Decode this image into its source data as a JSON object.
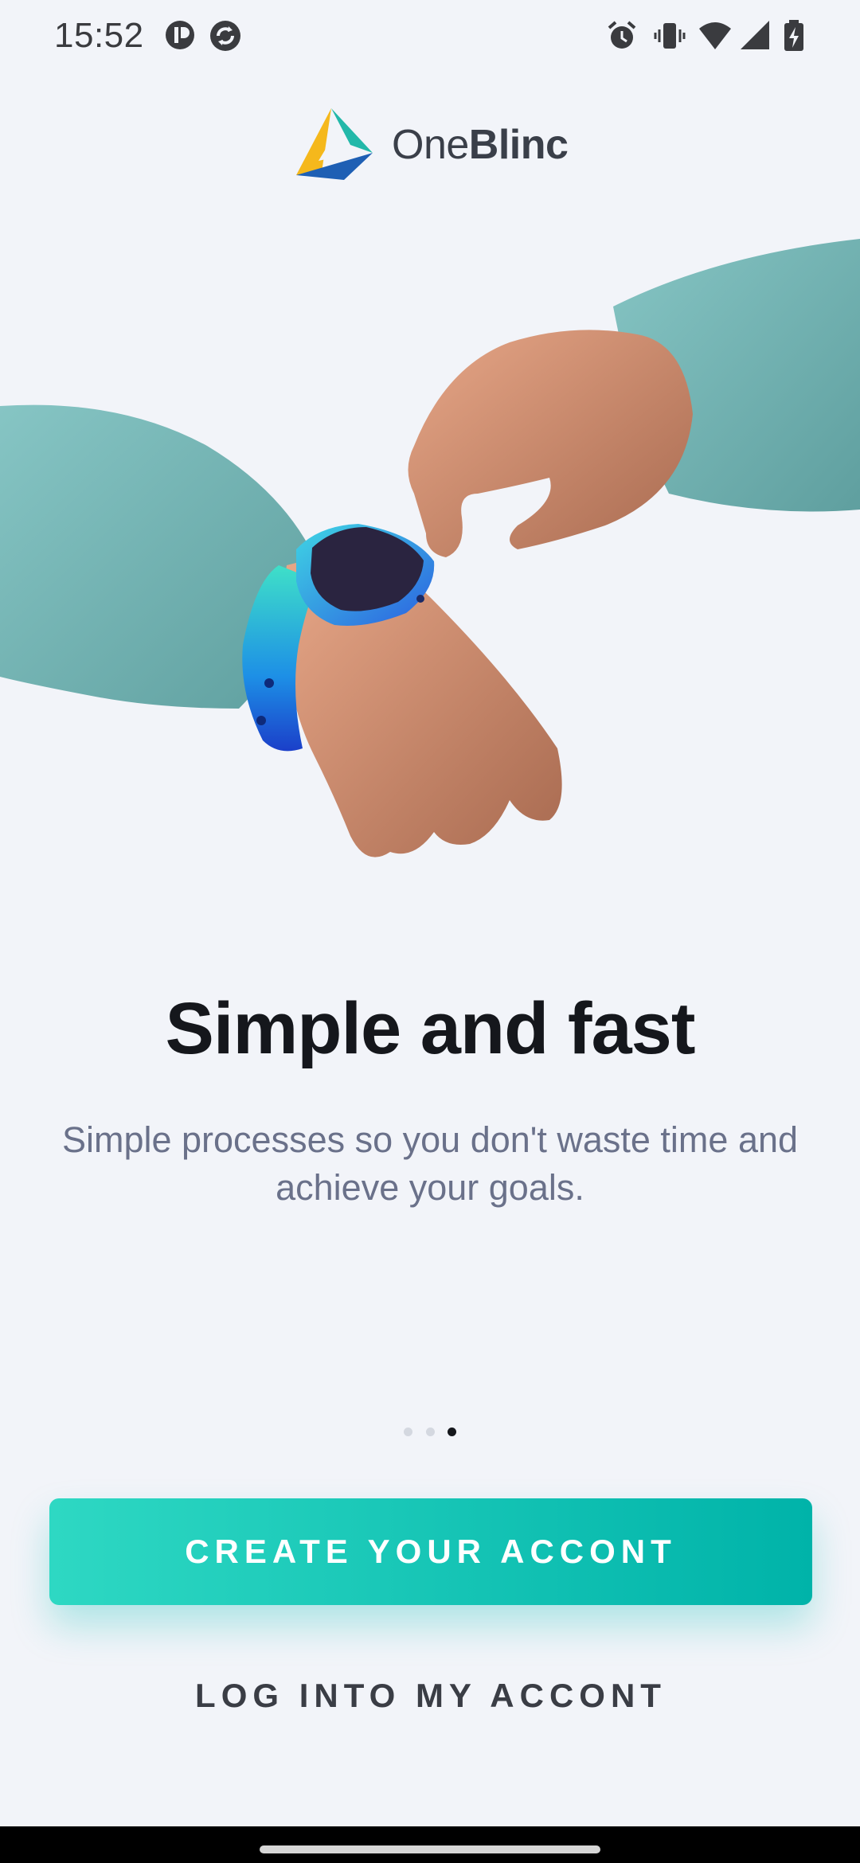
{
  "status_bar": {
    "time": "15:52",
    "left_icons": [
      "carrier-app-icon",
      "sync-icon"
    ],
    "right_icons": [
      "alarm-icon",
      "vibrate-icon",
      "wifi-icon",
      "signal-icon",
      "battery-charging-icon"
    ]
  },
  "brand": {
    "name_light": "One",
    "name_bold": "Blinc",
    "colors": {
      "yellow": "#f5b81c",
      "teal": "#23b8a9",
      "blue": "#1e5fb4"
    }
  },
  "onboarding": {
    "illustration_icon": "smartwatch-hands-illustration",
    "headline": "Simple and fast",
    "subtitle": "Simple processes so you don't waste time and achieve your goals.",
    "pager": {
      "total": 3,
      "active_index": 2
    }
  },
  "actions": {
    "create_account": "CREATE YOUR ACCONT",
    "login": "LOG INTO MY ACCONT"
  },
  "colors": {
    "background": "#f2f4f9",
    "accent_start": "#2ed8c3",
    "accent_end": "#00b3a9",
    "text_dark": "#15171c",
    "text_muted": "#6a718a"
  }
}
